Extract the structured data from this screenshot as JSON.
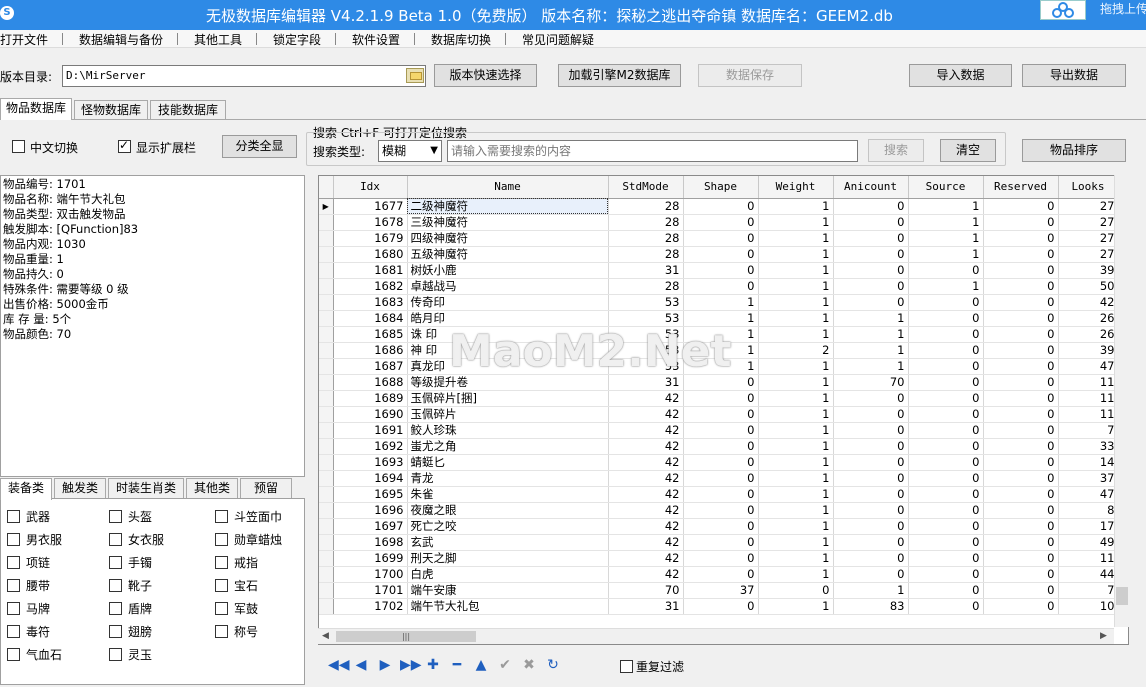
{
  "window": {
    "title": "无极数据库编辑器 V4.2.1.9    Beta 1.0（免费版）   版本名称：探秘之逃出夺命镇    数据库名：GEEM2.db",
    "drag_hint": "拖拽上传"
  },
  "menu": [
    "打开文件",
    "数据编辑与备份",
    "其他工具",
    "锁定字段",
    "软件设置",
    "数据库切换",
    "常见问题解疑"
  ],
  "toolbar": {
    "dir_label": "版本目录:",
    "dir_value": "D:\\MirServer",
    "quick_select": "版本快速选择",
    "load_engine": "加载引擎M2数据库",
    "save_data": "数据保存",
    "import_data": "导入数据",
    "export_data": "导出数据"
  },
  "main_tabs": [
    "物品数据库",
    "怪物数据库",
    "技能数据库"
  ],
  "options": {
    "chinese_switch": "中文切换",
    "show_ext": "显示扩展栏",
    "show_all": "分类全显"
  },
  "search": {
    "title": "搜索   Ctrl+F 可打开定位搜索",
    "type_label": "搜索类型:",
    "type_value": "模糊",
    "placeholder": "请输入需要搜索的内容",
    "search_btn": "搜索",
    "clear_btn": "清空",
    "sort_btn": "物品排序"
  },
  "item_info": [
    "物品编号: 1701",
    "物品名称: 端午节大礼包",
    "物品类型: 双击触发物品",
    "触发脚本: [QFunction]83",
    "物品内观: 1030",
    "物品重量: 1",
    "物品持久: 0",
    "特殊条件: 需要等级 0 级",
    "出售价格: 5000金币",
    "库 存 量: 5个",
    "物品颜色: 70"
  ],
  "category_tabs": [
    "装备类",
    "触发类",
    "时装生肖类",
    "其他类",
    "预留"
  ],
  "categories": [
    [
      "武器",
      "头盔",
      "斗笠面巾"
    ],
    [
      "男衣服",
      "女衣服",
      "勋章蜡烛"
    ],
    [
      "项链",
      "手镯",
      "戒指"
    ],
    [
      "腰带",
      "靴子",
      "宝石"
    ],
    [
      "马牌",
      "盾牌",
      "军鼓"
    ],
    [
      "毒符",
      "翅膀",
      "称号"
    ],
    [
      "气血石",
      "灵玉",
      ""
    ]
  ],
  "grid": {
    "columns": [
      "Idx",
      "Name",
      "StdMode",
      "Shape",
      "Weight",
      "Anicount",
      "Source",
      "Reserved",
      "Looks"
    ],
    "rows": [
      [
        "1677",
        "二级神魔符",
        "28",
        "0",
        "1",
        "0",
        "1",
        "0",
        "27"
      ],
      [
        "1678",
        "三级神魔符",
        "28",
        "0",
        "1",
        "0",
        "1",
        "0",
        "27"
      ],
      [
        "1679",
        "四级神魔符",
        "28",
        "0",
        "1",
        "0",
        "1",
        "0",
        "27"
      ],
      [
        "1680",
        "五级神魔符",
        "28",
        "0",
        "1",
        "0",
        "1",
        "0",
        "27"
      ],
      [
        "1681",
        "树妖小鹿",
        "31",
        "0",
        "1",
        "0",
        "0",
        "0",
        "39"
      ],
      [
        "1682",
        "卓越战马",
        "28",
        "0",
        "1",
        "0",
        "1",
        "0",
        "50"
      ],
      [
        "1683",
        "传奇印",
        "53",
        "1",
        "1",
        "0",
        "0",
        "0",
        "42"
      ],
      [
        "1684",
        "皓月印",
        "53",
        "1",
        "1",
        "1",
        "0",
        "0",
        "26"
      ],
      [
        "1685",
        "诛  印",
        "53",
        "1",
        "1",
        "1",
        "0",
        "0",
        "26"
      ],
      [
        "1686",
        "神  印",
        "53",
        "1",
        "2",
        "1",
        "0",
        "0",
        "39"
      ],
      [
        "1687",
        "真龙印",
        "53",
        "1",
        "1",
        "1",
        "0",
        "0",
        "47"
      ],
      [
        "1688",
        "等级提升卷",
        "31",
        "0",
        "1",
        "70",
        "0",
        "0",
        "11"
      ],
      [
        "1689",
        "玉佩碎片[捆]",
        "42",
        "0",
        "1",
        "0",
        "0",
        "0",
        "11"
      ],
      [
        "1690",
        "玉佩碎片",
        "42",
        "0",
        "1",
        "0",
        "0",
        "0",
        "11"
      ],
      [
        "1691",
        "鲛人珍珠",
        "42",
        "0",
        "1",
        "0",
        "0",
        "0",
        "7"
      ],
      [
        "1692",
        "蚩尤之角",
        "42",
        "0",
        "1",
        "0",
        "0",
        "0",
        "33"
      ],
      [
        "1693",
        "蜻蜓匕",
        "42",
        "0",
        "1",
        "0",
        "0",
        "0",
        "14"
      ],
      [
        "1694",
        "青龙",
        "42",
        "0",
        "1",
        "0",
        "0",
        "0",
        "37"
      ],
      [
        "1695",
        "朱雀",
        "42",
        "0",
        "1",
        "0",
        "0",
        "0",
        "47"
      ],
      [
        "1696",
        "夜魔之眼",
        "42",
        "0",
        "1",
        "0",
        "0",
        "0",
        "8"
      ],
      [
        "1697",
        "死亡之咬",
        "42",
        "0",
        "1",
        "0",
        "0",
        "0",
        "17"
      ],
      [
        "1698",
        "玄武",
        "42",
        "0",
        "1",
        "0",
        "0",
        "0",
        "49"
      ],
      [
        "1699",
        "刑天之脚",
        "42",
        "0",
        "1",
        "0",
        "0",
        "0",
        "11"
      ],
      [
        "1700",
        "白虎",
        "42",
        "0",
        "1",
        "0",
        "0",
        "0",
        "44"
      ],
      [
        "1701",
        "端午安康",
        "70",
        "37",
        "0",
        "1",
        "0",
        "0",
        "7"
      ],
      [
        "1702",
        "端午节大礼包",
        "31",
        "0",
        "1",
        "83",
        "0",
        "0",
        "10"
      ]
    ]
  },
  "watermark": "MaoM2.Net",
  "nav_buttons": [
    {
      "icon": "first-record-icon",
      "glyph": "◀◀",
      "enabled": true
    },
    {
      "icon": "prior-record-icon",
      "glyph": "◀",
      "enabled": true
    },
    {
      "icon": "next-record-icon",
      "glyph": "▶",
      "enabled": true
    },
    {
      "icon": "last-record-icon",
      "glyph": "▶▶",
      "enabled": true
    },
    {
      "icon": "insert-record-icon",
      "glyph": "✚",
      "enabled": true
    },
    {
      "icon": "delete-record-icon",
      "glyph": "━",
      "enabled": true
    },
    {
      "icon": "edit-record-icon",
      "glyph": "▲",
      "enabled": true
    },
    {
      "icon": "post-record-icon",
      "glyph": "✔",
      "enabled": false
    },
    {
      "icon": "cancel-record-icon",
      "glyph": "✖",
      "enabled": false
    },
    {
      "icon": "refresh-record-icon",
      "glyph": "↻",
      "enabled": true
    }
  ],
  "repeat_filter": "重复过滤"
}
